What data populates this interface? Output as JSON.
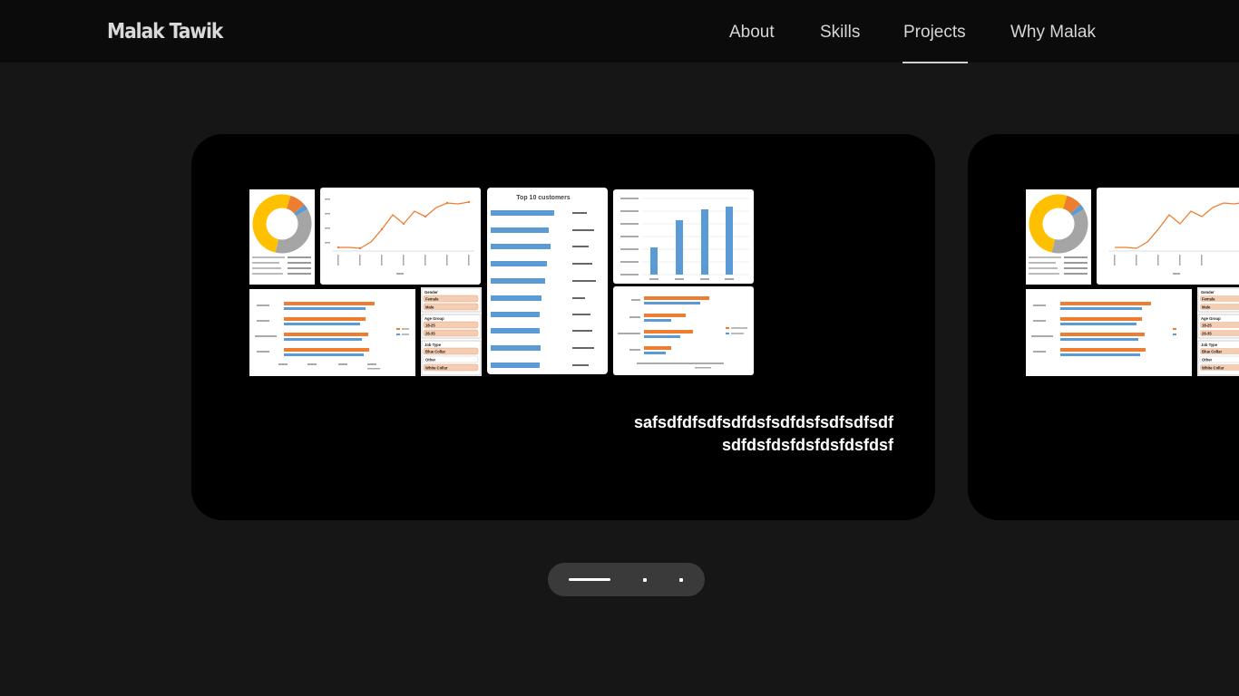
{
  "brand": "Malak Tawik",
  "nav": {
    "items": [
      {
        "label": "About"
      },
      {
        "label": "Skills"
      },
      {
        "label": "Projects"
      },
      {
        "label": "Why Malak"
      }
    ],
    "active": "Projects"
  },
  "carousel": {
    "slides": [
      {
        "text_line1": "safsdfdfsdfsdfdsfsdfdsfsdfsdfsdf",
        "text_line2": "sdfdsfdsfdsfdsfdsfdsf",
        "thumbnail": {
          "customers_title": "Top 10 customers",
          "slicer_labels": [
            "Gender",
            "Female",
            "Male",
            "Age Group",
            "18-25",
            "26-35",
            "Job Type",
            "Blue Collar",
            "Other",
            "White Collar"
          ]
        }
      },
      {
        "thumbnail": {
          "slicer_labels": [
            "Gender",
            "Female",
            "Male",
            "Age Group",
            "18-25",
            "26-35",
            "Job Type",
            "Blue Collar",
            "Other",
            "White Collar"
          ]
        }
      }
    ],
    "pager": {
      "count": 3,
      "active_index": 0
    }
  },
  "colors": {
    "background": "#161616",
    "navbar": "#0b0b0b",
    "card": "#000000",
    "pager": "#3a3a3a",
    "chart_orange": "#ed7d31",
    "chart_blue": "#5b9bd5",
    "chart_yellow": "#ffc000",
    "chart_grey": "#a5a5a5"
  }
}
